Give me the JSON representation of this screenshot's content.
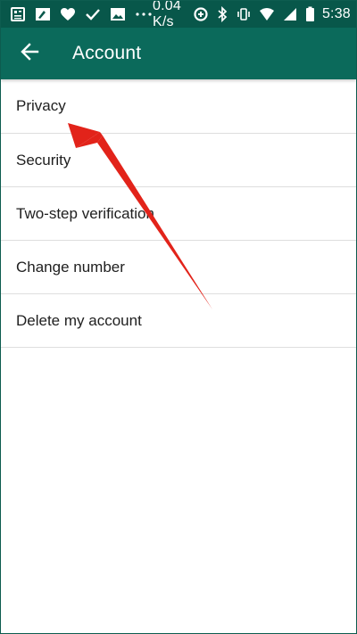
{
  "status_bar": {
    "speed": "0.04 K/s",
    "time": "5:38",
    "left_icons": [
      "news-icon",
      "image-edit-icon",
      "heart-icon",
      "check-icon",
      "gallery-icon",
      "more-dots-icon"
    ],
    "right_icons": [
      "data-saver-icon",
      "bluetooth-icon",
      "vibrate-icon",
      "wifi-icon",
      "signal-icon",
      "battery-icon"
    ]
  },
  "toolbar": {
    "back_icon": "back-arrow-icon",
    "title": "Account"
  },
  "menu": {
    "items": [
      {
        "label": "Privacy"
      },
      {
        "label": "Security"
      },
      {
        "label": "Two-step verification"
      },
      {
        "label": "Change number"
      },
      {
        "label": "Delete my account"
      }
    ]
  },
  "colors": {
    "status_bar": "#08574a",
    "toolbar": "#0b6a5b",
    "annotation_arrow": "#e2231a"
  }
}
